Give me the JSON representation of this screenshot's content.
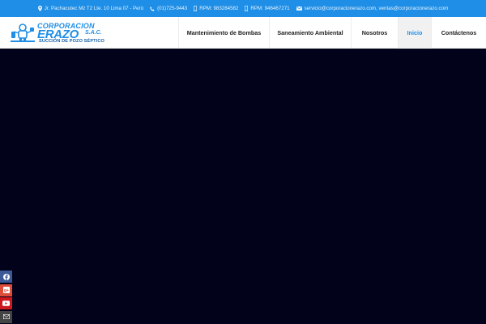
{
  "topbar": {
    "address": "Jr. Pachacutec Mz T2 Lte. 10 Lima 07 - Perú",
    "phone": "(01)725-9443",
    "rpm1": "RPM: 983284582",
    "rpm2": "RPM: 946467271",
    "email": "servicio@corporacionerazo.com, ventas@corporacionerazo.com"
  },
  "logo": {
    "line1": "CORPORACION",
    "line2": "ERAZO",
    "suffix": "S.A.C.",
    "tagline": "SUCCIÓN DE POZO SÉPTICO"
  },
  "nav": {
    "items": [
      {
        "label": "Mantenimiento de Bombas",
        "active": false
      },
      {
        "label": "Saneamiento Ambiental",
        "active": false
      },
      {
        "label": "Nosotros",
        "active": false
      },
      {
        "label": "Inicio",
        "active": true
      },
      {
        "label": "Contáctenos",
        "active": false
      }
    ]
  },
  "social": [
    {
      "icon": "facebook-icon",
      "color": "#3b5998"
    },
    {
      "icon": "google-plus-icon",
      "color": "#dd4b39"
    },
    {
      "icon": "youtube-icon",
      "color": "#cc181e"
    },
    {
      "icon": "mail-icon",
      "color": "#444444"
    }
  ],
  "colors": {
    "accent": "#1e8ee6",
    "hero_background": "#02031a"
  }
}
